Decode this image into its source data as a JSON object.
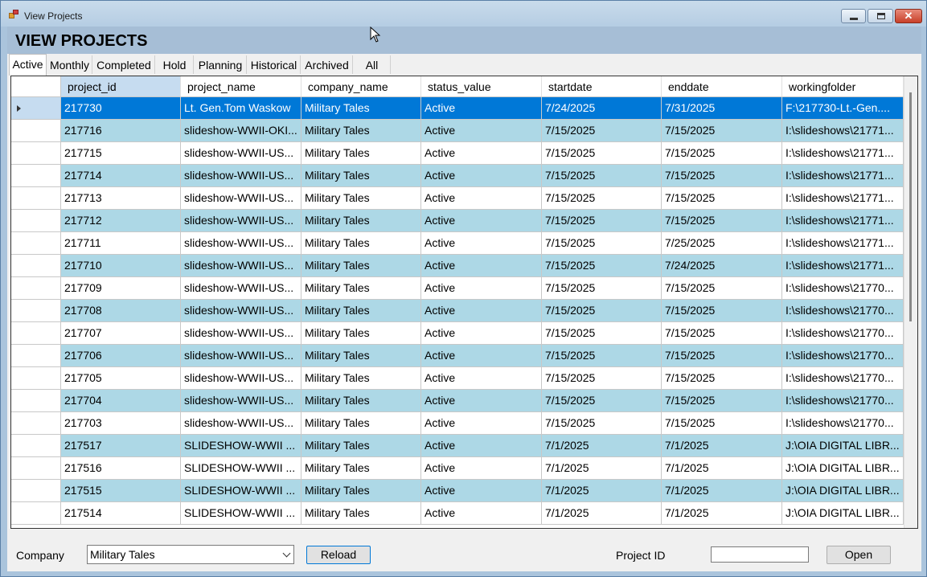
{
  "window": {
    "title": "View Projects"
  },
  "header": {
    "title": "VIEW PROJECTS"
  },
  "tabs": [
    {
      "label": "Active"
    },
    {
      "label": "Monthly"
    },
    {
      "label": "Completed"
    },
    {
      "label": "Hold"
    },
    {
      "label": "Planning"
    },
    {
      "label": "Historical"
    },
    {
      "label": "Archived"
    },
    {
      "label": "All"
    }
  ],
  "grid": {
    "columns": [
      "project_id",
      "project_name",
      "company_name",
      "status_value",
      "startdate",
      "enddate",
      "workingfolder"
    ],
    "rows": [
      [
        "217730",
        "Lt. Gen.Tom Waskow",
        "Military Tales",
        "Active",
        "7/24/2025",
        "7/31/2025",
        "F:\\217730-Lt.-Gen...."
      ],
      [
        "217716",
        "slideshow-WWII-OKI...",
        "Military Tales",
        "Active",
        "7/15/2025",
        "7/15/2025",
        "I:\\slideshows\\21771..."
      ],
      [
        "217715",
        "slideshow-WWII-US...",
        "Military Tales",
        "Active",
        "7/15/2025",
        "7/15/2025",
        "I:\\slideshows\\21771..."
      ],
      [
        "217714",
        "slideshow-WWII-US...",
        "Military Tales",
        "Active",
        "7/15/2025",
        "7/15/2025",
        "I:\\slideshows\\21771..."
      ],
      [
        "217713",
        "slideshow-WWII-US...",
        "Military Tales",
        "Active",
        "7/15/2025",
        "7/15/2025",
        "I:\\slideshows\\21771..."
      ],
      [
        "217712",
        "slideshow-WWII-US...",
        "Military Tales",
        "Active",
        "7/15/2025",
        "7/15/2025",
        "I:\\slideshows\\21771..."
      ],
      [
        "217711",
        "slideshow-WWII-US...",
        "Military Tales",
        "Active",
        "7/15/2025",
        "7/25/2025",
        "I:\\slideshows\\21771..."
      ],
      [
        "217710",
        "slideshow-WWII-US...",
        "Military Tales",
        "Active",
        "7/15/2025",
        "7/24/2025",
        "I:\\slideshows\\21771..."
      ],
      [
        "217709",
        "slideshow-WWII-US...",
        "Military Tales",
        "Active",
        "7/15/2025",
        "7/15/2025",
        "I:\\slideshows\\21770..."
      ],
      [
        "217708",
        "slideshow-WWII-US...",
        "Military Tales",
        "Active",
        "7/15/2025",
        "7/15/2025",
        "I:\\slideshows\\21770..."
      ],
      [
        "217707",
        "slideshow-WWII-US...",
        "Military Tales",
        "Active",
        "7/15/2025",
        "7/15/2025",
        "I:\\slideshows\\21770..."
      ],
      [
        "217706",
        "slideshow-WWII-US...",
        "Military Tales",
        "Active",
        "7/15/2025",
        "7/15/2025",
        "I:\\slideshows\\21770..."
      ],
      [
        "217705",
        "slideshow-WWII-US...",
        "Military Tales",
        "Active",
        "7/15/2025",
        "7/15/2025",
        "I:\\slideshows\\21770..."
      ],
      [
        "217704",
        "slideshow-WWII-US...",
        "Military Tales",
        "Active",
        "7/15/2025",
        "7/15/2025",
        "I:\\slideshows\\21770..."
      ],
      [
        "217703",
        "slideshow-WWII-US...",
        "Military Tales",
        "Active",
        "7/15/2025",
        "7/15/2025",
        "I:\\slideshows\\21770..."
      ],
      [
        "217517",
        "SLIDESHOW-WWII ...",
        "Military Tales",
        "Active",
        "7/1/2025",
        "7/1/2025",
        "J:\\OIA DIGITAL LIBR..."
      ],
      [
        "217516",
        "SLIDESHOW-WWII ...",
        "Military Tales",
        "Active",
        "7/1/2025",
        "7/1/2025",
        "J:\\OIA DIGITAL LIBR..."
      ],
      [
        "217515",
        "SLIDESHOW-WWII ...",
        "Military Tales",
        "Active",
        "7/1/2025",
        "7/1/2025",
        "J:\\OIA DIGITAL LIBR..."
      ],
      [
        "217514",
        "SLIDESHOW-WWII ...",
        "Military Tales",
        "Active",
        "7/1/2025",
        "7/1/2025",
        "J:\\OIA DIGITAL LIBR..."
      ]
    ]
  },
  "footer": {
    "company_label": "Company",
    "company_value": "Military Tales",
    "reload_label": "Reload",
    "project_id_label": "Project ID",
    "project_id_value": "",
    "open_label": "Open"
  },
  "colors": {
    "selected_row": "#0078d7",
    "alt_row": "#add8e6",
    "header_bar": "#a6bed6"
  }
}
